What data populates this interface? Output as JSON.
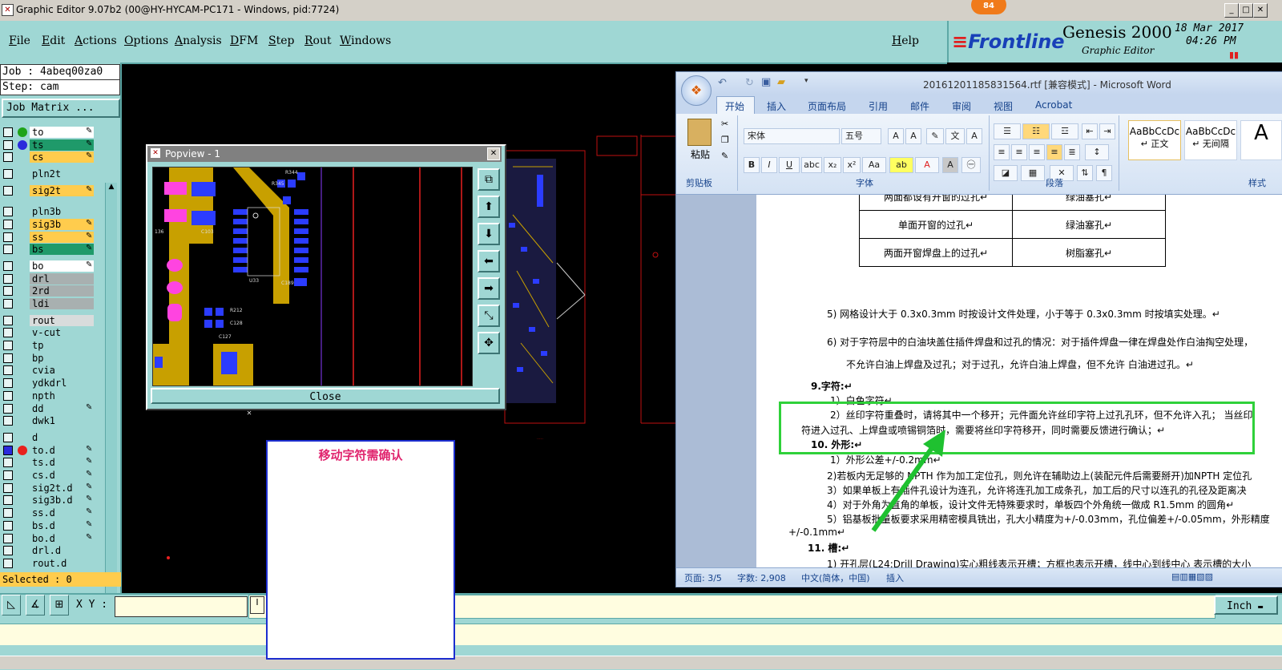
{
  "window": {
    "title": "Graphic Editor 9.07b2 (00@HY-HYCAM-PC171 - Windows, pid:7724)",
    "badge": "84"
  },
  "menu": [
    "File",
    "Edit",
    "Actions",
    "Options",
    "Analysis",
    "DFM",
    "Step",
    "Rout",
    "Windows"
  ],
  "help": "Help",
  "brand": {
    "logo": "Frontline",
    "product": "Genesis 2000",
    "subtitle": "Graphic Editor",
    "date": "18 Mar 2017",
    "time": "04:26 PM"
  },
  "job": {
    "job_line": "Job : 4abeq00za0",
    "step_line": "Step: cam",
    "matrix_button": "Job Matrix ..."
  },
  "layers": [
    {
      "name": "to",
      "fill": "#ffffff",
      "dot": "#1fa319",
      "pen": true
    },
    {
      "name": "ts",
      "fill": "#1f9a6a",
      "dot": "#2b2bdc",
      "pen": true
    },
    {
      "name": "cs",
      "fill": "#ffcc4d",
      "dot": "",
      "pen": true
    },
    {
      "name": "pln2t",
      "fill": "#9fd7d4",
      "dot": "",
      "pen": false
    },
    {
      "name": "sig2t",
      "fill": "#ffcc4d",
      "dot": "",
      "pen": true
    },
    {
      "name": "pln3b",
      "fill": "#9fd7d4",
      "dot": "",
      "pen": false
    },
    {
      "name": "sig3b",
      "fill": "#ffcc4d",
      "dot": "",
      "pen": true
    },
    {
      "name": "ss",
      "fill": "#ffcc4d",
      "dot": "",
      "pen": true
    },
    {
      "name": "bs",
      "fill": "#1f9a6a",
      "dot": "",
      "pen": true
    },
    {
      "name": "bo",
      "fill": "#ffffff",
      "dot": "",
      "pen": true
    },
    {
      "name": "drl",
      "fill": "#a8b0b0",
      "dot": "",
      "pen": false
    },
    {
      "name": "2rd",
      "fill": "#a8b0b0",
      "dot": "",
      "pen": false
    },
    {
      "name": "ldi",
      "fill": "#a8b0b0",
      "dot": "",
      "pen": false
    },
    {
      "name": "rout",
      "fill": "#d8dcdc",
      "dot": "",
      "pen": false
    },
    {
      "name": "v-cut",
      "fill": "#9fd7d4",
      "dot": "",
      "pen": false
    },
    {
      "name": "tp",
      "fill": "#9fd7d4",
      "dot": "",
      "pen": false
    },
    {
      "name": "bp",
      "fill": "#9fd7d4",
      "dot": "",
      "pen": false
    },
    {
      "name": "cvia",
      "fill": "#9fd7d4",
      "dot": "",
      "pen": false
    },
    {
      "name": "ydkdrl",
      "fill": "#9fd7d4",
      "dot": "",
      "pen": false
    },
    {
      "name": "npth",
      "fill": "#9fd7d4",
      "dot": "",
      "pen": false
    },
    {
      "name": "dd",
      "fill": "#9fd7d4",
      "dot": "",
      "pen": true
    },
    {
      "name": "dwk1",
      "fill": "#9fd7d4",
      "dot": "",
      "pen": false
    },
    {
      "name": "d",
      "fill": "#9fd7d4",
      "dot": "",
      "pen": false
    },
    {
      "name": "to.d",
      "fill": "#9fd7d4",
      "dot": "#e8211d",
      "pen": true
    },
    {
      "name": "ts.d",
      "fill": "#9fd7d4",
      "dot": "",
      "pen": true
    },
    {
      "name": "cs.d",
      "fill": "#9fd7d4",
      "dot": "",
      "pen": true
    },
    {
      "name": "sig2t.d",
      "fill": "#9fd7d4",
      "dot": "",
      "pen": true
    },
    {
      "name": "sig3b.d",
      "fill": "#9fd7d4",
      "dot": "",
      "pen": true
    },
    {
      "name": "ss.d",
      "fill": "#9fd7d4",
      "dot": "",
      "pen": true
    },
    {
      "name": "bs.d",
      "fill": "#9fd7d4",
      "dot": "",
      "pen": true
    },
    {
      "name": "bo.d",
      "fill": "#9fd7d4",
      "dot": "",
      "pen": true
    },
    {
      "name": "drl.d",
      "fill": "#9fd7d4",
      "dot": "",
      "pen": false
    },
    {
      "name": "rout.d",
      "fill": "#9fd7d4",
      "dot": "",
      "pen": false
    }
  ],
  "selected": "Selected : 0",
  "xy_label": "X Y :",
  "units_button": "Inch",
  "popview": {
    "title": "Popview - 1",
    "close": "Close"
  },
  "note": {
    "text": "移动字符需确认"
  },
  "word": {
    "title": "20161201185831564.rtf [兼容模式] - Microsoft Word",
    "tabs": [
      "开始",
      "插入",
      "页面布局",
      "引用",
      "邮件",
      "审阅",
      "视图",
      "Acrobat"
    ],
    "paste": "粘贴",
    "font_name": "宋体",
    "font_size": "五号",
    "group_labels": {
      "clipboard": "剪贴板",
      "font": "字体",
      "paragraph": "段落",
      "styles": "样式"
    },
    "styles": [
      {
        "sample": "AaBbCcDc",
        "name": "↵ 正文"
      },
      {
        "sample": "AaBbCcDc",
        "name": "↵ 无间隔"
      }
    ],
    "table": [
      [
        "两面都设有开窗的过孔↵",
        "绿油塞孔↵"
      ],
      [
        "单面开窗的过孔↵",
        "绿油塞孔↵"
      ],
      [
        "两面开窗焊盘上的过孔↵",
        "树脂塞孔↵"
      ]
    ],
    "lines": [
      "5)  网格设计大于 0.3x0.3mm 时按设计文件处理，小于等于 0.3x0.3mm 时按填实处理。↵",
      "6)  对于字符层中的白油块盖住插件焊盘和过孔的情况：对于插件焊盘一律在焊盘处作白油掏空处理，",
      "不允许白油上焊盘及过孔；对于过孔，允许白油上焊盘，但不允许 白油进过孔。↵",
      "9.字符:↵",
      "1）白色字符↵",
      "2）丝印字符重叠时，请将其中一个移开；元件面允许丝印字符上过孔孔环，但不允许入孔；  当丝印",
      "符进入过孔、上焊盘或喷锡铜箔时，需要将丝印字符移开，同时需要反馈进行确认；↵",
      "10. 外形:↵",
      "1）外形公差+/-0.2mm↵",
      "2)若板内无足够的 NPTH 作为加工定位孔，则允许在辅助边上(装配元件后需要掰开)加NPTH 定位孔",
      "3）如果单板上有插件孔设计为连孔，允许将连孔加工成条孔，加工后的尺寸以连孔的孔径及距离决",
      "4）对于外角为直角的单板，设计文件无特殊要求时，单板四个外角统一做成 R1.5mm 的圆角↵",
      "5）铝基板批量板要求采用精密模具铣出，孔大小精度为+/-0.03mm，孔位偏差+/-0.05mm，外形精度",
      "+/-0.1mm↵",
      "11. 槽:↵",
      "1)  开孔层(L24:Drill Drawing)实心粗线表示开槽；方框也表示开槽，线中心到线中心 表示槽的大小"
    ],
    "status": {
      "page": "页面: 3/5",
      "words": "字数: 2,908",
      "lang": "中文(简体，中国)",
      "mode": "插入"
    }
  },
  "colors": {
    "panel": "#9fd7d4",
    "highlight": "#2fd13a",
    "arrow": "#1fc130",
    "note_border": "#1c2dcf",
    "note_text": "#e0246e"
  }
}
